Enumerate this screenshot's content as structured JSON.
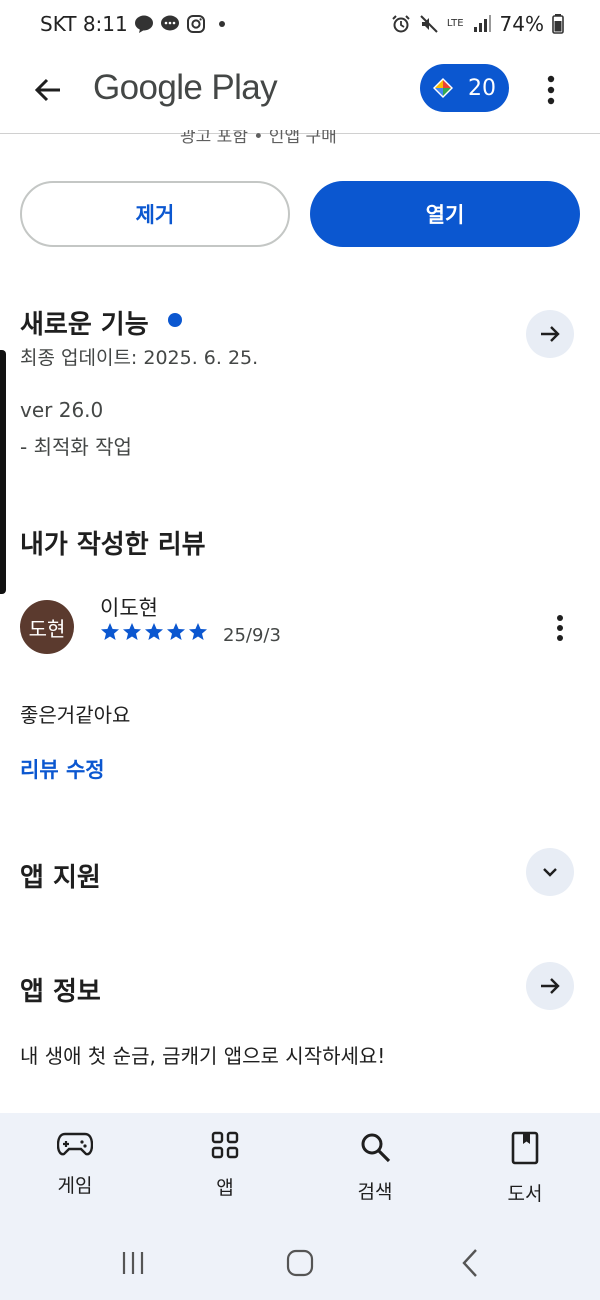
{
  "status_bar": {
    "carrier_time": "SKT 8:11",
    "network": "LTE",
    "battery": "74%"
  },
  "header": {
    "logo_text": "Google Play",
    "points": "20"
  },
  "top_cut_text": "광고 포함 • 인앱 구매",
  "actions": {
    "remove_label": "제거",
    "open_label": "열기"
  },
  "whats_new": {
    "title": "새로운 기능",
    "updated": "최종 업데이트: 2025. 6. 25.",
    "version": "ver 26.0",
    "note": "- 최적화 작업"
  },
  "my_review": {
    "title": "내가 작성한 리뷰",
    "avatar_text": "도현",
    "author": "이도현",
    "rating": 5,
    "date": "25/9/3",
    "text": "좋은거같아요",
    "edit_label": "리뷰 수정"
  },
  "app_support": {
    "title": "앱 지원"
  },
  "app_info": {
    "title": "앱 정보",
    "description": "내 생애 첫 순금, 금캐기 앱으로 시작하세요!"
  },
  "bottom_nav": {
    "items": [
      {
        "label": "게임",
        "icon": "gamepad-icon"
      },
      {
        "label": "앱",
        "icon": "apps-grid-icon"
      },
      {
        "label": "검색",
        "icon": "search-icon"
      },
      {
        "label": "도서",
        "icon": "book-icon"
      }
    ]
  },
  "colors": {
    "accent": "#0b57d0",
    "nav_bg": "#eef2f9",
    "avatar_bg": "#5b3a2e"
  }
}
